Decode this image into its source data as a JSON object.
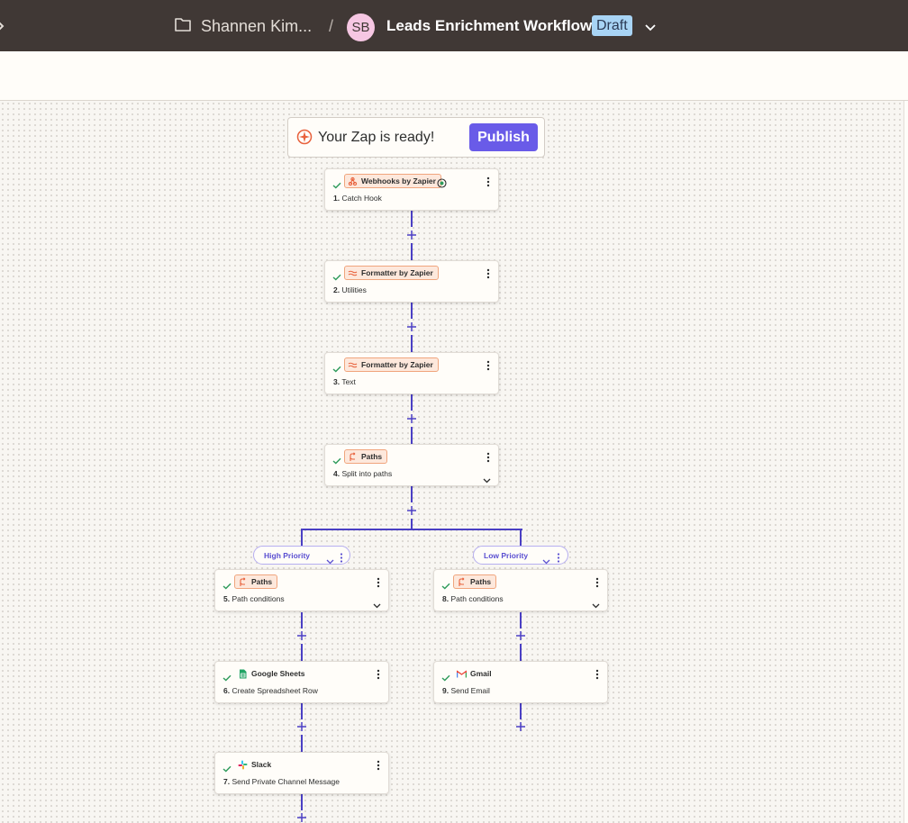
{
  "topbar": {
    "folder_name": "Shannen Kim...",
    "separator": "/",
    "avatar_initials": "SB",
    "zap_title": "Leads Enrichment Workflow",
    "status_badge": "Draft"
  },
  "banner": {
    "message": "Your Zap is ready!",
    "publish_label": "Publish"
  },
  "steps": [
    {
      "number": "1.",
      "name": "Catch Hook",
      "app": "Webhooks by Zapier",
      "icon": "webhook-icon"
    },
    {
      "number": "2.",
      "name": "Utilities",
      "app": "Formatter by Zapier",
      "icon": "formatter-icon"
    },
    {
      "number": "3.",
      "name": "Text",
      "app": "Formatter by Zapier",
      "icon": "formatter-icon"
    },
    {
      "number": "4.",
      "name": "Split into paths",
      "app": "Paths",
      "icon": "paths-icon"
    },
    {
      "number": "5.",
      "name": "Path conditions",
      "app": "Paths",
      "icon": "paths-icon"
    },
    {
      "number": "6.",
      "name": "Create Spreadsheet Row",
      "app": "Google Sheets",
      "icon": "google-sheets-icon"
    },
    {
      "number": "7.",
      "name": "Send Private Channel Message",
      "app": "Slack",
      "icon": "slack-icon"
    },
    {
      "number": "8.",
      "name": "Path conditions",
      "app": "Paths",
      "icon": "paths-icon"
    },
    {
      "number": "9.",
      "name": "Send Email",
      "app": "Gmail",
      "icon": "gmail-icon"
    }
  ],
  "paths": [
    {
      "label": "High Priority"
    },
    {
      "label": "Low Priority"
    }
  ],
  "colors": {
    "topbar_bg": "#403835",
    "accent": "#695be8",
    "connector": "#4a3fc4",
    "draft_badge": "#a8d4f5",
    "chip_orange": "#fde8dc",
    "check_green": "#2e9b5b"
  }
}
